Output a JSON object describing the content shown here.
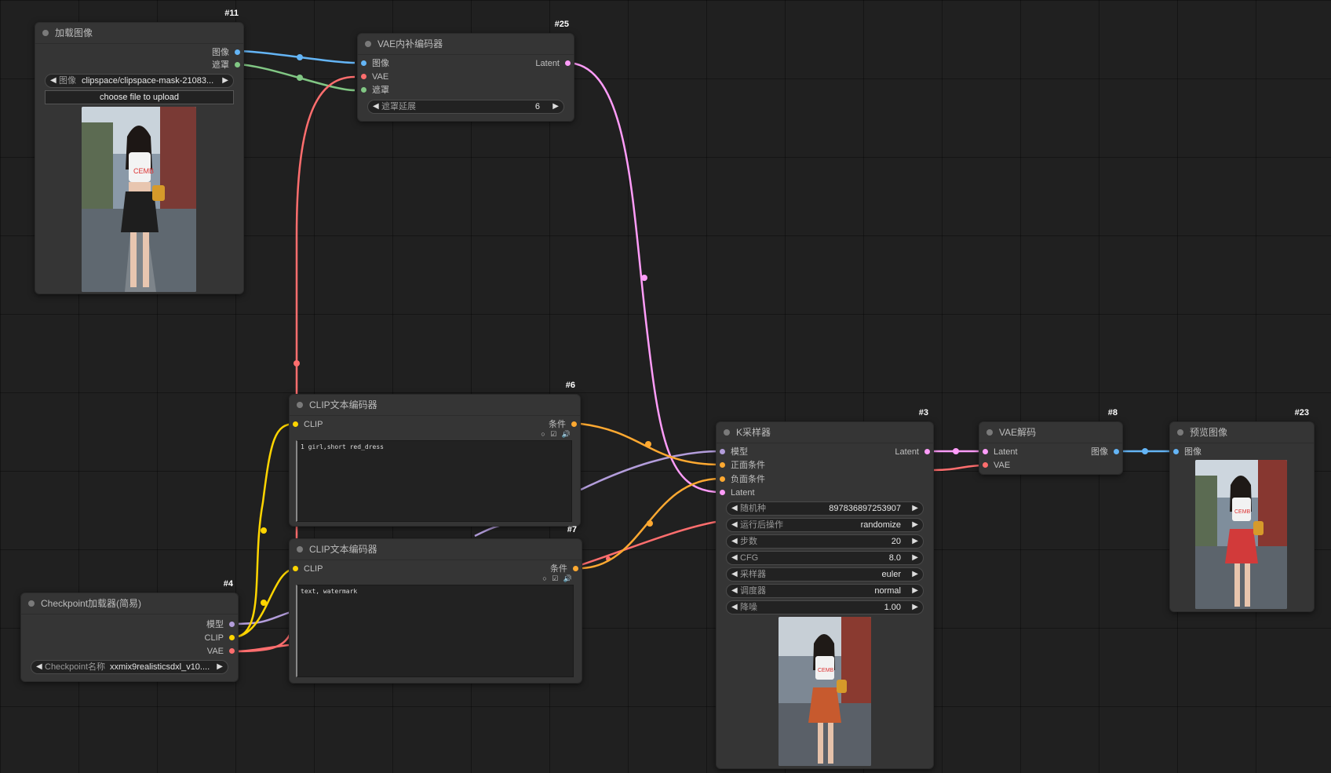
{
  "colors": {
    "image": "#64b5f6",
    "mask": "#81c784",
    "vae": "#ff6e6e",
    "latent": "#ff9cf9",
    "clip": "#ffd500",
    "conditioning": "#ffa931",
    "model": "#b39ddb",
    "background": "#202020",
    "node_bg": "#353535"
  },
  "nodes": {
    "load_image": {
      "id": "#11",
      "title": "加载图像",
      "outputs": [
        "图像",
        "遮罩"
      ],
      "image_widget": {
        "label": "图像",
        "value": "clipspace/clipspace-mask-21083..."
      },
      "upload_label": "choose file to upload",
      "thumbnail_icon": "photo-girl-white-top-black-skirt"
    },
    "vae_inpaint": {
      "id": "#25",
      "title": "VAE内补编码器",
      "inputs": [
        "图像",
        "VAE",
        "遮罩"
      ],
      "output": "Latent",
      "grow_widget": {
        "label": "遮罩延展",
        "value": "6"
      }
    },
    "clip_positive": {
      "id": "#6",
      "title": "CLIP文本编码器",
      "input": "CLIP",
      "output": "条件",
      "text": "1 girl,short red_dress",
      "icons": "○ ☑ 🔊"
    },
    "clip_negative": {
      "id": "#7",
      "title": "CLIP文本编码器",
      "input": "CLIP",
      "output": "条件",
      "text": "text, watermark",
      "icons": "○ ☑ 🔊"
    },
    "checkpoint": {
      "id": "#4",
      "title": "Checkpoint加载器(简易)",
      "outputs": [
        "模型",
        "CLIP",
        "VAE"
      ],
      "ckpt_widget": {
        "label": "Checkpoint名称",
        "value": "xxmix9realisticsdxl_v10...."
      }
    },
    "ksampler": {
      "id": "#3",
      "title": "K采样器",
      "inputs": [
        "模型",
        "正面条件",
        "负面条件",
        "Latent"
      ],
      "output": "Latent",
      "widgets": [
        {
          "label": "随机种",
          "value": "897836897253907"
        },
        {
          "label": "运行后操作",
          "value": "randomize"
        },
        {
          "label": "步数",
          "value": "20"
        },
        {
          "label": "CFG",
          "value": "8.0"
        },
        {
          "label": "采样器",
          "value": "euler"
        },
        {
          "label": "调度器",
          "value": "normal"
        },
        {
          "label": "降噪",
          "value": "1.00"
        }
      ],
      "thumbnail_icon": "photo-girl-orange-skirt"
    },
    "vae_decode": {
      "id": "#8",
      "title": "VAE解码",
      "inputs": [
        "Latent",
        "VAE"
      ],
      "output": "图像"
    },
    "preview": {
      "id": "#23",
      "title": "预览图像",
      "input": "图像",
      "thumbnail_icon": "photo-girl-red-skirt"
    }
  }
}
